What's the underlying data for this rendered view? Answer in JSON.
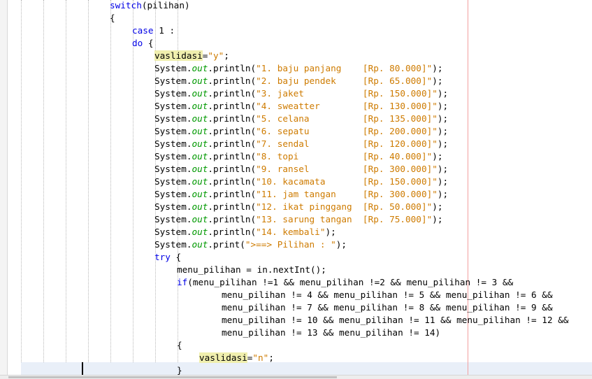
{
  "editor": {
    "colors": {
      "keyword": "#0000e6",
      "string": "#ce7b00",
      "field": "#009900",
      "highlight": "#f0efae",
      "margin_line": "#f2a0a0",
      "current_line": "#e9eff8"
    },
    "lines": [
      [
        [
          "switch",
          "kw"
        ],
        [
          "(pilihan)",
          ""
        ]
      ],
      [
        [
          "{",
          ""
        ]
      ],
      [
        [
          "case",
          "kw"
        ],
        [
          " 1 :",
          ""
        ]
      ],
      [
        [
          "do",
          "kw"
        ],
        [
          " {",
          ""
        ]
      ],
      [
        [
          "vaslidasi",
          "hl"
        ],
        [
          "=",
          ""
        ],
        [
          "\"y\"",
          "str"
        ],
        [
          ";",
          ""
        ]
      ],
      [
        [
          "System.",
          ""
        ],
        [
          "out",
          "fld"
        ],
        [
          ".println(",
          ""
        ],
        [
          "\"1. baju panjang    [Rp. 80.000]\"",
          "str"
        ],
        [
          ");",
          ""
        ]
      ],
      [
        [
          "System.",
          ""
        ],
        [
          "out",
          "fld"
        ],
        [
          ".println(",
          ""
        ],
        [
          "\"2. baju pendek     [Rp. 65.000]\"",
          "str"
        ],
        [
          ");",
          ""
        ]
      ],
      [
        [
          "System.",
          ""
        ],
        [
          "out",
          "fld"
        ],
        [
          ".println(",
          ""
        ],
        [
          "\"3. jaket           [Rp. 150.000]\"",
          "str"
        ],
        [
          ");",
          ""
        ]
      ],
      [
        [
          "System.",
          ""
        ],
        [
          "out",
          "fld"
        ],
        [
          ".println(",
          ""
        ],
        [
          "\"4. sweatter        [Rp. 130.000]\"",
          "str"
        ],
        [
          ");",
          ""
        ]
      ],
      [
        [
          "System.",
          ""
        ],
        [
          "out",
          "fld"
        ],
        [
          ".println(",
          ""
        ],
        [
          "\"5. celana          [Rp. 135.000]\"",
          "str"
        ],
        [
          ");",
          ""
        ]
      ],
      [
        [
          "System.",
          ""
        ],
        [
          "out",
          "fld"
        ],
        [
          ".println(",
          ""
        ],
        [
          "\"6. sepatu          [Rp. 200.000]\"",
          "str"
        ],
        [
          ");",
          ""
        ]
      ],
      [
        [
          "System.",
          ""
        ],
        [
          "out",
          "fld"
        ],
        [
          ".println(",
          ""
        ],
        [
          "\"7. sendal          [Rp. 120.000]\"",
          "str"
        ],
        [
          ");",
          ""
        ]
      ],
      [
        [
          "System.",
          ""
        ],
        [
          "out",
          "fld"
        ],
        [
          ".println(",
          ""
        ],
        [
          "\"8. topi            [Rp. 40.000]\"",
          "str"
        ],
        [
          ");",
          ""
        ]
      ],
      [
        [
          "System.",
          ""
        ],
        [
          "out",
          "fld"
        ],
        [
          ".println(",
          ""
        ],
        [
          "\"9. ransel          [Rp. 300.000]\"",
          "str"
        ],
        [
          ");",
          ""
        ]
      ],
      [
        [
          "System.",
          ""
        ],
        [
          "out",
          "fld"
        ],
        [
          ".println(",
          ""
        ],
        [
          "\"10. kacamata       [Rp. 150.000]\"",
          "str"
        ],
        [
          ");",
          ""
        ]
      ],
      [
        [
          "System.",
          ""
        ],
        [
          "out",
          "fld"
        ],
        [
          ".println(",
          ""
        ],
        [
          "\"11. jam tangan     [Rp. 300.000]\"",
          "str"
        ],
        [
          ");",
          ""
        ]
      ],
      [
        [
          "System.",
          ""
        ],
        [
          "out",
          "fld"
        ],
        [
          ".println(",
          ""
        ],
        [
          "\"12. ikat pinggang  [Rp. 50.000]\"",
          "str"
        ],
        [
          ");",
          ""
        ]
      ],
      [
        [
          "System.",
          ""
        ],
        [
          "out",
          "fld"
        ],
        [
          ".println(",
          ""
        ],
        [
          "\"13. sarung tangan  [Rp. 75.000]\"",
          "str"
        ],
        [
          ");",
          ""
        ]
      ],
      [
        [
          "System.",
          ""
        ],
        [
          "out",
          "fld"
        ],
        [
          ".println(",
          ""
        ],
        [
          "\"14. kembali\"",
          "str"
        ],
        [
          ");",
          ""
        ]
      ],
      [
        [
          "System.",
          ""
        ],
        [
          "out",
          "fld"
        ],
        [
          ".print(",
          ""
        ],
        [
          "\">==> Pilihan : \"",
          "str"
        ],
        [
          ");",
          ""
        ]
      ],
      [
        [
          "try",
          "kw"
        ],
        [
          " {",
          ""
        ]
      ],
      [
        [
          "menu_pilihan = in.nextInt();",
          ""
        ]
      ],
      [
        [
          "if",
          "kw"
        ],
        [
          "(menu_pilihan !=1 && menu_pilihan !=2 && menu_pilihan != 3 &&",
          ""
        ]
      ],
      [
        [
          "menu_pilihan != 4 && menu_pilihan != 5 && menu_pilihan != 6 &&",
          ""
        ]
      ],
      [
        [
          "menu_pilihan != 7 && menu_pilihan != 8 && menu_pilihan != 9 &&",
          ""
        ]
      ],
      [
        [
          "menu_pilihan != 10 && menu_pilihan != 11 && menu_pilihan != 12 &&",
          ""
        ]
      ],
      [
        [
          "menu_pilihan != 13 && menu_pilihan != 14)",
          ""
        ]
      ],
      [
        [
          "{",
          ""
        ]
      ],
      [
        [
          "vaslidasi",
          "hl"
        ],
        [
          "=",
          ""
        ],
        [
          "\"n\"",
          "str"
        ],
        [
          ";",
          ""
        ]
      ],
      [
        [
          "}",
          ""
        ]
      ]
    ]
  }
}
